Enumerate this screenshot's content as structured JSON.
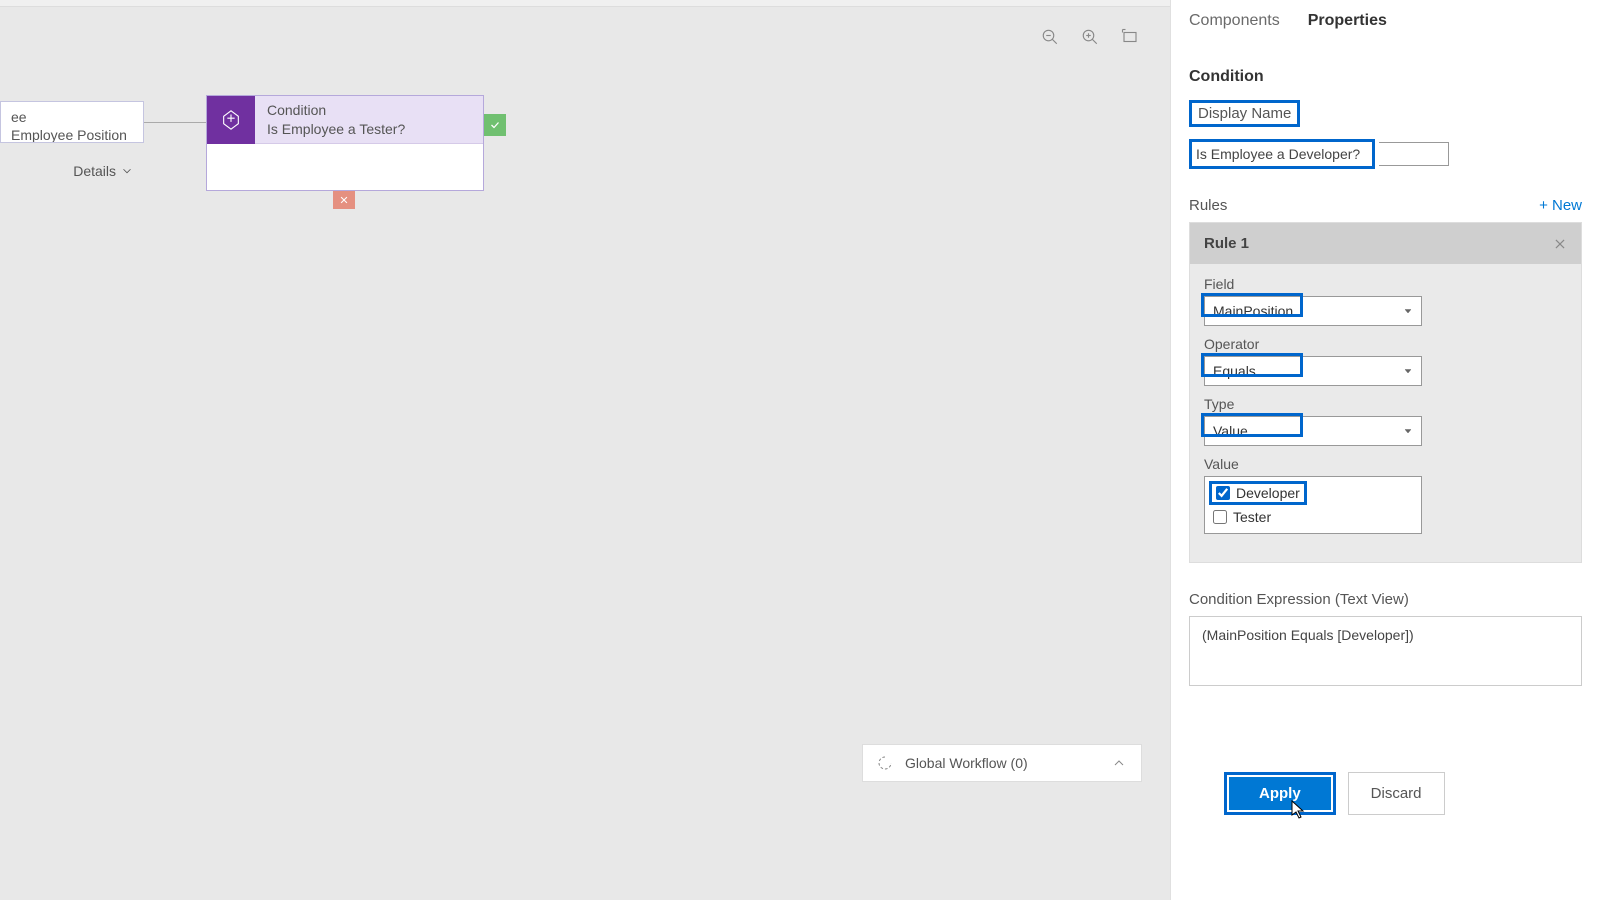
{
  "canvas": {
    "entityNode": {
      "line1": "ee",
      "line2": "Employee Position",
      "details": "Details"
    },
    "conditionNode": {
      "typeLabel": "Condition",
      "title": "Is Employee a Tester?"
    },
    "bottomPanel": {
      "label": "Global Workflow (0)"
    }
  },
  "panel": {
    "tabs": {
      "components": "Components",
      "properties": "Properties"
    },
    "condition": {
      "heading": "Condition",
      "displayNameLabel": "Display Name",
      "displayNameValue": "Is Employee a Developer?"
    },
    "rules": {
      "label": "Rules",
      "newLabel": "+ New",
      "rule1": {
        "title": "Rule 1",
        "fieldLabel": "Field",
        "fieldValue": "MainPosition",
        "operatorLabel": "Operator",
        "operatorValue": "Equals",
        "typeLabel": "Type",
        "typeValue": "Value",
        "valueLabel": "Value",
        "options": {
          "developer": "Developer",
          "tester": "Tester"
        }
      }
    },
    "expression": {
      "label": "Condition Expression (Text View)",
      "value": "(MainPosition Equals [Developer])"
    },
    "actions": {
      "apply": "Apply",
      "discard": "Discard"
    }
  }
}
